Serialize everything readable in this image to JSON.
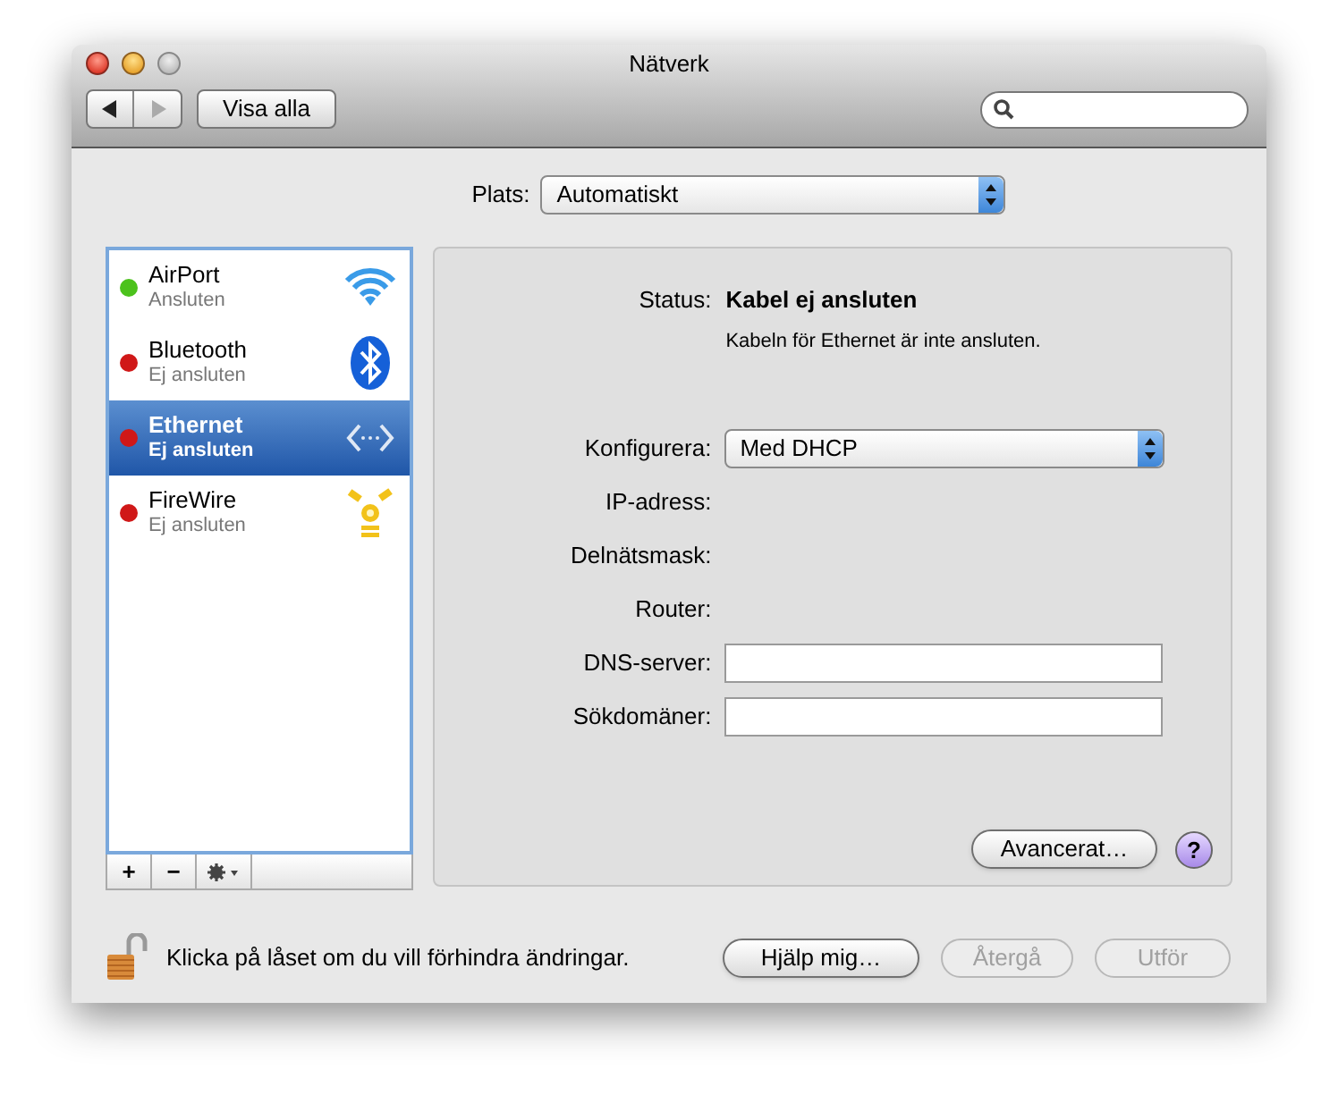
{
  "window": {
    "title": "Nätverk"
  },
  "toolbar": {
    "show_all": "Visa alla",
    "back_disabled": false,
    "forward_disabled": true
  },
  "location": {
    "label": "Plats:",
    "value": "Automatiskt"
  },
  "services": [
    {
      "name": "AirPort",
      "status": "Ansluten",
      "color": "#4cc21c",
      "selected": false
    },
    {
      "name": "Bluetooth",
      "status": "Ej ansluten",
      "color": "#d01818",
      "selected": false
    },
    {
      "name": "Ethernet",
      "status": "Ej ansluten",
      "color": "#d01818",
      "selected": true
    },
    {
      "name": "FireWire",
      "status": "Ej ansluten",
      "color": "#d01818",
      "selected": false
    }
  ],
  "list_buttons": [
    "+",
    "−"
  ],
  "status": {
    "label": "Status:",
    "value": "Kabel ej ansluten",
    "detail": "Kabeln för Ethernet är inte ansluten."
  },
  "fields": [
    {
      "kind": "popup",
      "label": "Konfigurera:",
      "value": "Med DHCP"
    },
    {
      "kind": "text",
      "label": "IP-adress:"
    },
    {
      "kind": "text",
      "label": "Delnätsmask:"
    },
    {
      "kind": "text",
      "label": "Router:"
    },
    {
      "kind": "input",
      "label": "DNS-server:"
    },
    {
      "kind": "input",
      "label": "Sökdomäner:"
    }
  ],
  "advanced": "Avancerat…",
  "help": "?",
  "lock_text": "Klicka på låset om du vill förhindra ändringar.",
  "buttons": [
    {
      "label": "Hjälp mig…",
      "disabled": false
    },
    {
      "label": "Återgå",
      "disabled": true
    },
    {
      "label": "Utför",
      "disabled": true
    }
  ]
}
